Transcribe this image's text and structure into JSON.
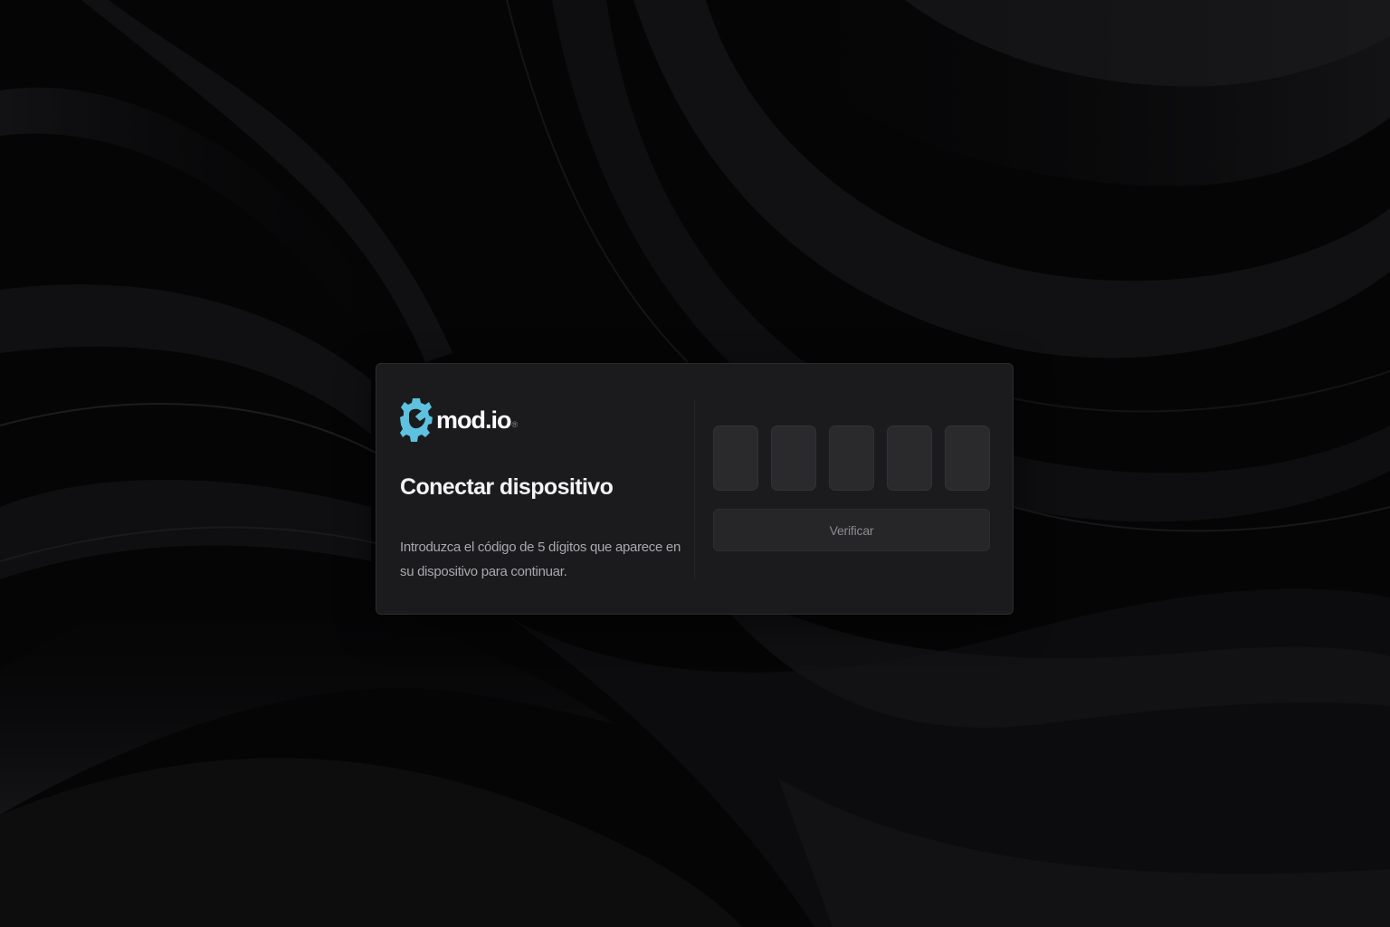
{
  "brand": {
    "name": "mod.io",
    "trademark": "®",
    "accent_color": "#5ec1e0"
  },
  "dialog": {
    "title": "Conectar dispositivo",
    "description": "Introduzca el código de 5 dígitos que aparece en su dispositivo para continuar.",
    "code_digits": [
      "",
      "",
      "",
      "",
      ""
    ],
    "verify_label": "Verificar"
  },
  "colors": {
    "background": "#050506",
    "card": "#1b1b1d",
    "input": "#2a2a2d",
    "button": "#262628"
  }
}
